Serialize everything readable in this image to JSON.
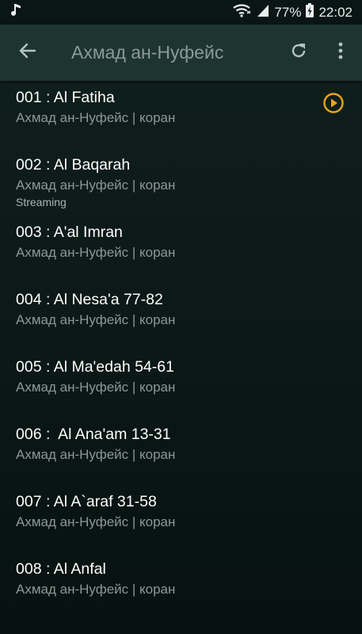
{
  "status_bar": {
    "battery_percent": "77%",
    "time": "22:02",
    "music_icon": "music-note-icon",
    "wifi_icon": "wifi-icon",
    "signal_icon": "signal-icon",
    "battery_icon": "battery-charging-icon"
  },
  "app_bar": {
    "title": "Ахмад ан-Нуфейс",
    "back_icon": "arrow-back-icon",
    "refresh_icon": "refresh-icon",
    "more_icon": "more-vert-icon"
  },
  "colors": {
    "accent": "#e8a420",
    "app_bar_bg": "#1e3430",
    "background": "#0c1a18"
  },
  "tracks": [
    {
      "title": "001 : Al Fatiha",
      "subtitle": "Ахмад ан-Нуфейс | коран"
    },
    {
      "title": "002 : Al Baqarah",
      "subtitle": "Ахмад ан-Нуфейс | коран",
      "status": "Streaming",
      "playing": true
    },
    {
      "title": "003 : A'al Imran",
      "subtitle": "Ахмад ан-Нуфейс | коран"
    },
    {
      "title": "004 : Al Nesa'a 77-82",
      "subtitle": "Ахмад ан-Нуфейс | коран"
    },
    {
      "title": "005 : Al Ma'edah 54-61",
      "subtitle": "Ахмад ан-Нуфейс | коран"
    },
    {
      "title": "006 :  Al Ana'am 13-31",
      "subtitle": "Ахмад ан-Нуфейс | коран"
    },
    {
      "title": "007 : Al A`araf 31-58",
      "subtitle": "Ахмад ан-Нуфейс | коран"
    },
    {
      "title": "008 : Al Anfal",
      "subtitle": "Ахмад ан-Нуфейс | коран"
    }
  ],
  "play_icon": "play-circle-icon"
}
